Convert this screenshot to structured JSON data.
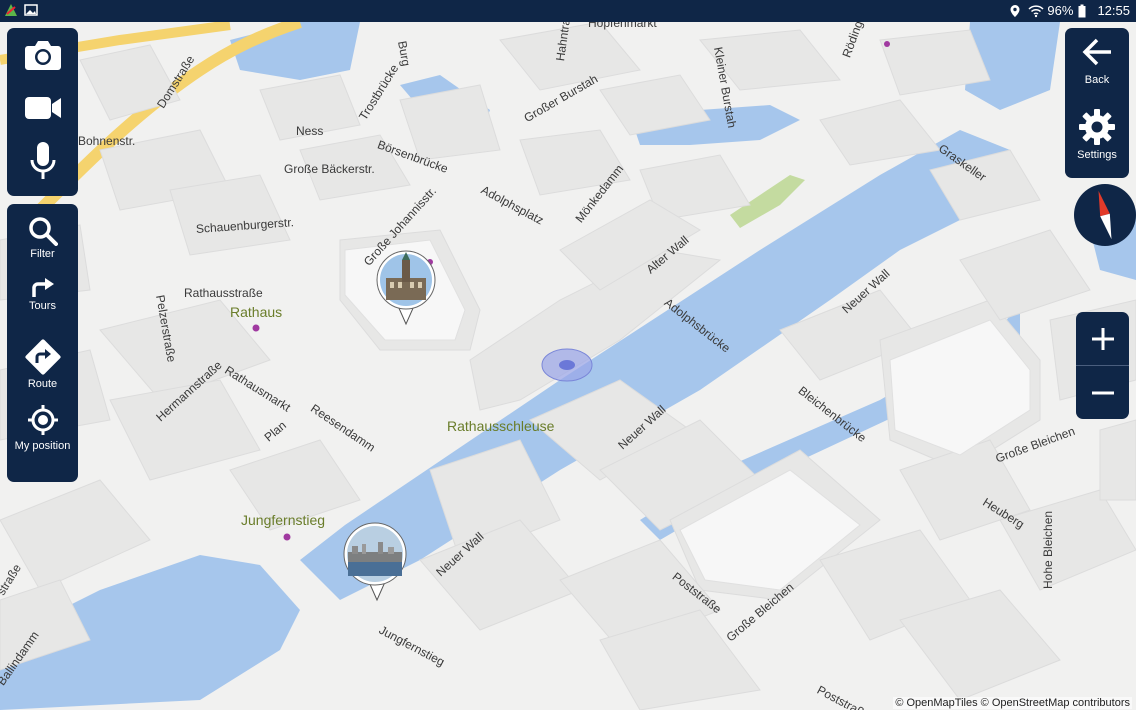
{
  "status_bar": {
    "battery": "96%",
    "time": "12:55"
  },
  "toolbar_media": {
    "items": [
      {
        "icon": "camera-icon",
        "label": ""
      },
      {
        "icon": "video-camera-icon",
        "label": ""
      },
      {
        "icon": "microphone-icon",
        "label": ""
      }
    ]
  },
  "toolbar_tools": {
    "filter": "Filter",
    "tours": "Tours",
    "route": "Route",
    "my_position": "My position"
  },
  "toolbar_nav": {
    "back": "Back",
    "settings": "Settings"
  },
  "zoom": {
    "in": "+",
    "out": "−"
  },
  "map": {
    "street_labels": [
      "Domstraße",
      "Hopfenmarkt",
      "Burg",
      "Hahntrapp",
      "Ness",
      "Trostbrücke",
      "Großer Burstah",
      "Börsenbrücke",
      "Große Bäckerstr.",
      "Adolphsplatz",
      "Mönkedamm",
      "Schauenburgerstr.",
      "Große Johannisstr.",
      "Pelzerstraße",
      "Rathausstraße",
      "Alter Wall",
      "Adolphsbrücke",
      "Neuer Wall",
      "Rathausmarkt",
      "Hermannstraße",
      "Reesendamm",
      "Plan",
      "Bleichenbrücke",
      "Neuer Wall",
      "Große Bleichen",
      "Heuberg",
      "Poststraße",
      "Große Bleichen",
      "Hohe Bleichen",
      "Jungfernstieg",
      "Neuer Wall",
      "Graskeller",
      "Rödingsmarkt",
      "Ballindamm",
      "Poststraße",
      "Bohnenstr.",
      "Kleiner Burstah",
      "straße"
    ],
    "poi_labels": [
      "Rathaus",
      "Rathausschleuse",
      "Jungfernstieg"
    ],
    "attribution": "© OpenMapTiles © OpenStreetMap contributors"
  },
  "colors": {
    "toolbar_bg": "#0f2647",
    "water": "#a6c6ec",
    "road_major": "#f5d36e",
    "poi_purple": "#a039a0",
    "location_dot": "#6b78d8"
  }
}
